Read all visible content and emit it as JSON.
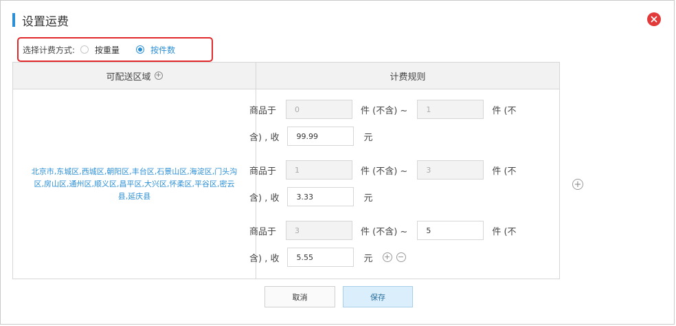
{
  "dialog": {
    "title": "设置运费",
    "accent_color": "#2b8fd6"
  },
  "method": {
    "label": "选择计费方式:",
    "options": [
      {
        "label": "按重量",
        "checked": false
      },
      {
        "label": "按件数",
        "checked": true
      }
    ]
  },
  "table": {
    "headers": {
      "region": "可配送区域",
      "rule": "计费规则"
    },
    "region_text": "北京市,东城区,西城区,朝阳区,丰台区,石景山区,海淀区,门头沟区,房山区,通州区,顺义区,昌平区,大兴区,怀柔区,平谷区,密云县,延庆县",
    "rule_labels": {
      "prefix": "商品于",
      "piece_excl": "件 (不含) ~",
      "piece_tail": "件 (不",
      "charge": "含) , 收",
      "currency": "元"
    },
    "rules": [
      {
        "from": "0",
        "to": "1",
        "price": "99.99"
      },
      {
        "from": "1",
        "to": "3",
        "price": "3.33"
      },
      {
        "from": "3",
        "to": "5",
        "price": "5.55"
      }
    ]
  },
  "buttons": {
    "cancel": "取消",
    "save": "保存"
  },
  "icons": {
    "close": "close-icon",
    "add": "plus-circle-icon",
    "remove": "minus-circle-icon"
  }
}
